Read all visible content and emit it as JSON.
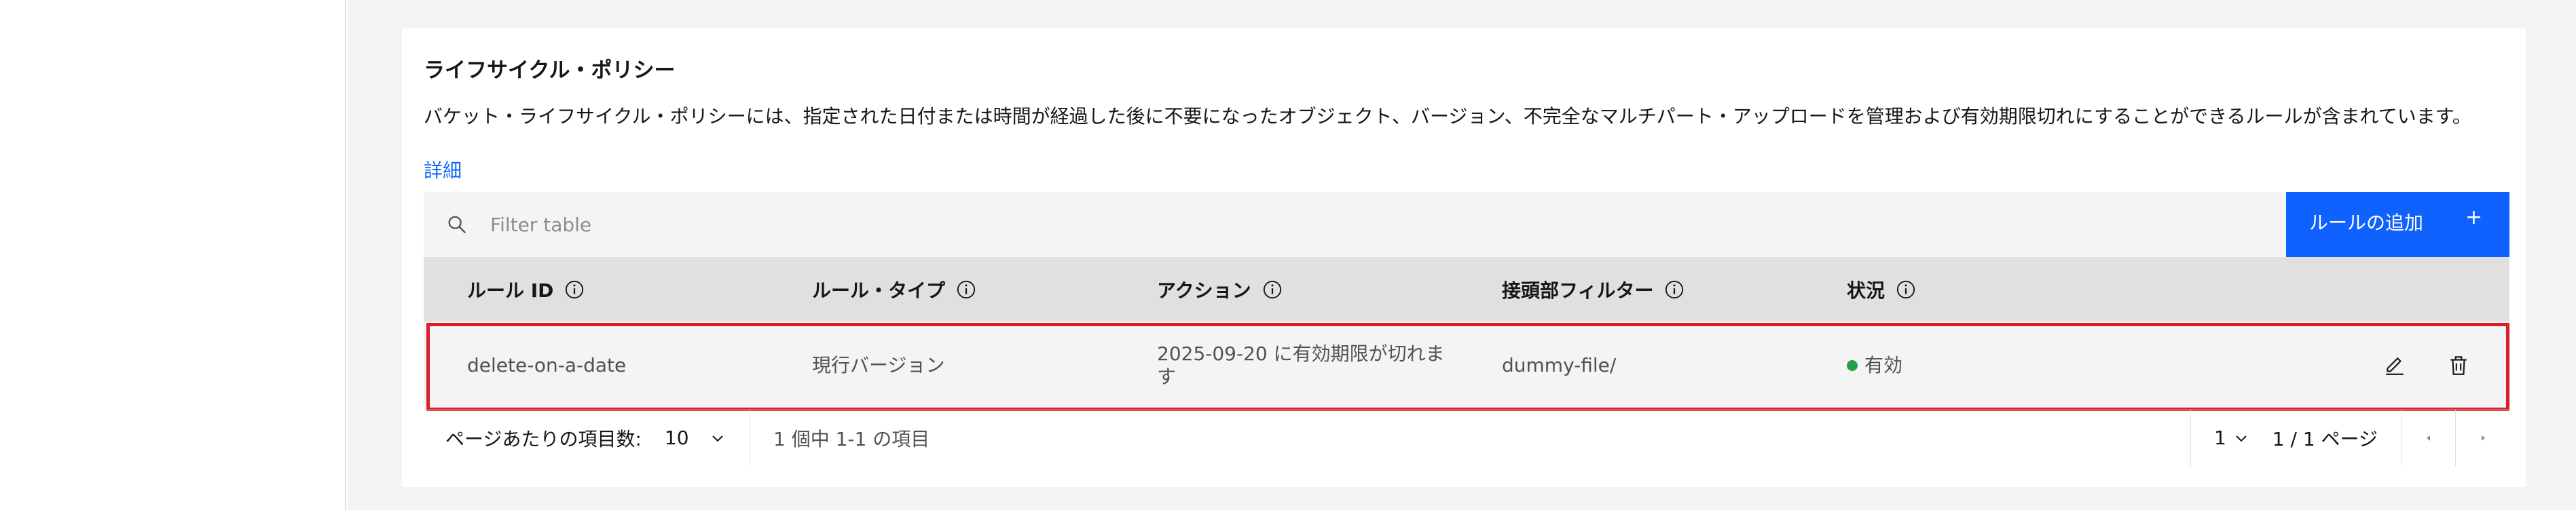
{
  "section": {
    "title": "ライフサイクル・ポリシー",
    "description": "バケット・ライフサイクル・ポリシーには、指定された日付または時間が経過した後に不要になったオブジェクト、バージョン、不完全なマルチパート・アップロードを管理および有効期限切れにすることができるルールが含まれています。",
    "details_link": "詳細"
  },
  "toolbar": {
    "search_placeholder": "Filter table",
    "add_rule_label": "ルールの追加",
    "add_icon": "+"
  },
  "table": {
    "columns": [
      {
        "label": "ルール ID",
        "info_icon": "info-icon"
      },
      {
        "label": "ルール・タイプ",
        "info_icon": "info-icon"
      },
      {
        "label": "アクション",
        "info_icon": "info-icon"
      },
      {
        "label": "接頭部フィルター",
        "info_icon": "info-icon"
      },
      {
        "label": "状況",
        "info_icon": "info-icon"
      }
    ],
    "rows": [
      {
        "rule_id": "delete-on-a-date",
        "rule_type": "現行バージョン",
        "action": "2025-09-20 に有効期限が切れます",
        "prefix_filter": "dummy-file/",
        "status": "有効",
        "status_color": "#24a148"
      }
    ]
  },
  "pagination": {
    "items_per_page_label": "ページあたりの項目数:",
    "items_per_page_value": "10",
    "range_text": "1 個中 1-1 の項目",
    "page_value": "1",
    "page_total_text": "1 / 1 ページ"
  },
  "colors": {
    "primary": "#0f62fe",
    "highlight_border": "#da1e28",
    "status_active": "#24a148"
  }
}
